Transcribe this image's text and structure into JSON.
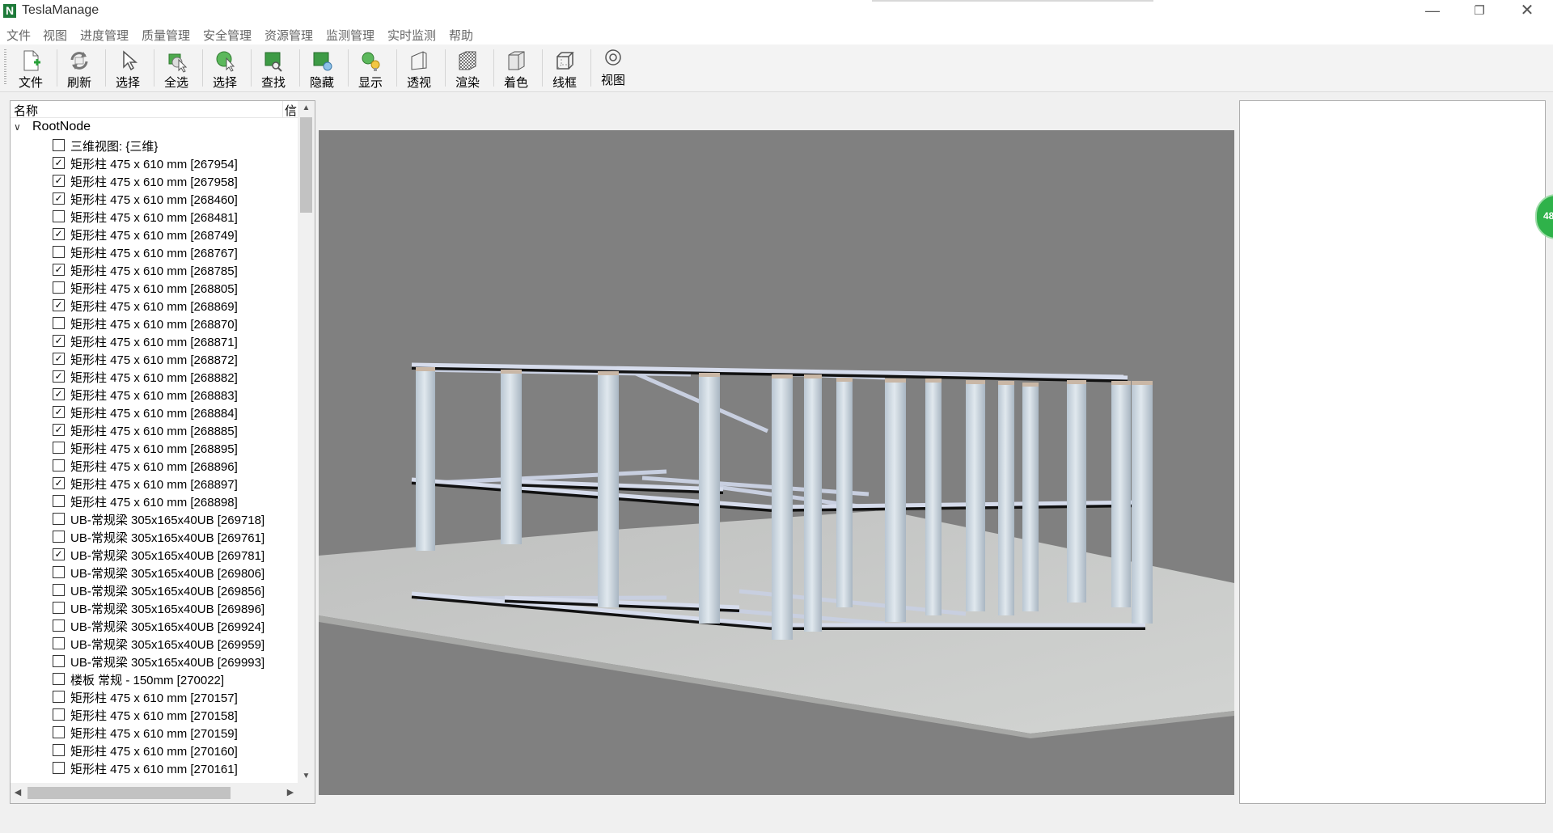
{
  "app": {
    "logo": "N",
    "title": "TeslaManage",
    "window_buttons": {
      "minimize": "—",
      "maximize": "❐",
      "close": "✕"
    }
  },
  "menu": [
    "文件",
    "视图",
    "进度管理",
    "质量管理",
    "安全管理",
    "资源管理",
    "监测管理",
    "实时监测",
    "帮助"
  ],
  "toolbar": [
    {
      "label": "文件",
      "icon": "new-file-icon"
    },
    {
      "label": "刷新",
      "icon": "refresh-icon"
    },
    {
      "label": "选择",
      "icon": "cursor-icon"
    },
    {
      "label": "全选",
      "icon": "select-all-icon"
    },
    {
      "label": "选择",
      "icon": "select-sphere-icon"
    },
    {
      "label": "查找",
      "icon": "find-icon"
    },
    {
      "label": "隐藏",
      "icon": "hide-icon"
    },
    {
      "label": "显示",
      "icon": "show-icon"
    },
    {
      "label": "透视",
      "icon": "perspective-icon"
    },
    {
      "label": "渲染",
      "icon": "render-icon"
    },
    {
      "label": "着色",
      "icon": "shade-icon"
    },
    {
      "label": "线框",
      "icon": "wireframe-icon"
    },
    {
      "label": "视图",
      "icon": "view-icon"
    }
  ],
  "tree": {
    "columns": {
      "name": "名称",
      "info": "信"
    },
    "root": "RootNode",
    "items": [
      {
        "label": "三维视图: {三维}",
        "checked": false
      },
      {
        "label": "矩形柱 475 x 610 mm [267954]",
        "checked": true
      },
      {
        "label": "矩形柱 475 x 610 mm [267958]",
        "checked": true
      },
      {
        "label": "矩形柱 475 x 610 mm [268460]",
        "checked": true
      },
      {
        "label": "矩形柱 475 x 610 mm [268481]",
        "checked": false
      },
      {
        "label": "矩形柱 475 x 610 mm [268749]",
        "checked": true
      },
      {
        "label": "矩形柱 475 x 610 mm [268767]",
        "checked": false
      },
      {
        "label": "矩形柱 475 x 610 mm [268785]",
        "checked": true
      },
      {
        "label": "矩形柱 475 x 610 mm [268805]",
        "checked": false
      },
      {
        "label": "矩形柱 475 x 610 mm [268869]",
        "checked": true
      },
      {
        "label": "矩形柱 475 x 610 mm [268870]",
        "checked": false
      },
      {
        "label": "矩形柱 475 x 610 mm [268871]",
        "checked": true
      },
      {
        "label": "矩形柱 475 x 610 mm [268872]",
        "checked": true
      },
      {
        "label": "矩形柱 475 x 610 mm [268882]",
        "checked": true
      },
      {
        "label": "矩形柱 475 x 610 mm [268883]",
        "checked": true
      },
      {
        "label": "矩形柱 475 x 610 mm [268884]",
        "checked": true
      },
      {
        "label": "矩形柱 475 x 610 mm [268885]",
        "checked": true
      },
      {
        "label": "矩形柱 475 x 610 mm [268895]",
        "checked": false
      },
      {
        "label": "矩形柱 475 x 610 mm [268896]",
        "checked": false
      },
      {
        "label": "矩形柱 475 x 610 mm [268897]",
        "checked": true
      },
      {
        "label": "矩形柱 475 x 610 mm [268898]",
        "checked": false
      },
      {
        "label": "UB-常规梁 305x165x40UB [269718]",
        "checked": false
      },
      {
        "label": "UB-常规梁 305x165x40UB [269761]",
        "checked": false
      },
      {
        "label": "UB-常规梁 305x165x40UB [269781]",
        "checked": true
      },
      {
        "label": "UB-常规梁 305x165x40UB [269806]",
        "checked": false
      },
      {
        "label": "UB-常规梁 305x165x40UB [269856]",
        "checked": false
      },
      {
        "label": "UB-常规梁 305x165x40UB [269896]",
        "checked": false
      },
      {
        "label": "UB-常规梁 305x165x40UB [269924]",
        "checked": false
      },
      {
        "label": "UB-常规梁 305x165x40UB [269959]",
        "checked": false
      },
      {
        "label": "UB-常规梁 305x165x40UB [269993]",
        "checked": false
      },
      {
        "label": "楼板 常规 - 150mm [270022]",
        "checked": false
      },
      {
        "label": "矩形柱 475 x 610 mm [270157]",
        "checked": false
      },
      {
        "label": "矩形柱 475 x 610 mm [270158]",
        "checked": false
      },
      {
        "label": "矩形柱 475 x 610 mm [270159]",
        "checked": false
      },
      {
        "label": "矩形柱 475 x 610 mm [270160]",
        "checked": false
      },
      {
        "label": "矩形柱 475 x 610 mm [270161]",
        "checked": false
      }
    ]
  },
  "float_badge": "48",
  "colors": {
    "viewport_bg": "#808080",
    "floor": "#c9cac8",
    "column": "#cdd7df",
    "beam_edge": "#111111",
    "badge": "#2fb24a"
  }
}
